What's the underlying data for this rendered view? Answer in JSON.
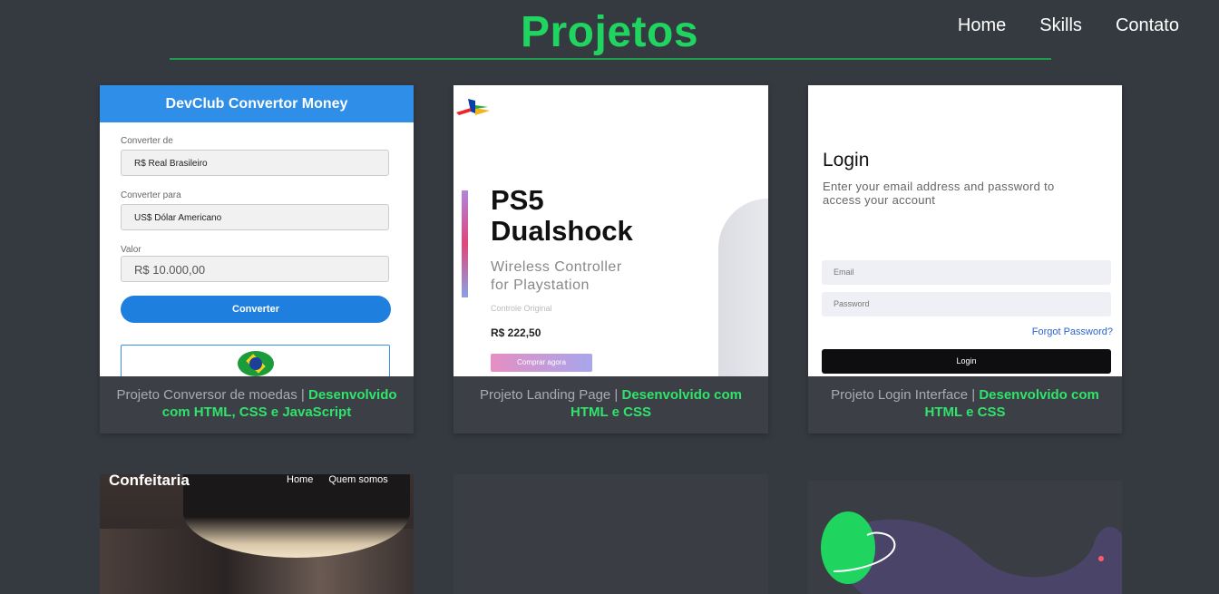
{
  "header": {
    "title": "Projetos",
    "nav": [
      "Home",
      "Skills",
      "Contato"
    ]
  },
  "colors": {
    "accent": "#1fd560",
    "background": "#353a40",
    "card": "#3c4046"
  },
  "projects": [
    {
      "caption_text": "Projeto Conversor de moedas | ",
      "caption_highlight": "Desenvolvido com HTML, CSS e JavaScript",
      "preview": {
        "heading": "DevClub Convertor Money",
        "label_from": "Converter de",
        "value_from": "R$ Real Brasileiro",
        "label_to": "Converter para",
        "value_to": "US$ Dólar Americano",
        "label_value": "Valor",
        "value_amount": "R$ 10.000,00",
        "button": "Converter"
      }
    },
    {
      "caption_text": "Projeto Landing Page | ",
      "caption_highlight": "Desenvolvido com HTML e CSS",
      "preview": {
        "title_line1": "PS5",
        "title_line2": "Dualshock",
        "subtitle_line1": "Wireless Controller",
        "subtitle_line2": "for Playstation",
        "small": "Controle Original",
        "price": "R$ 222,50",
        "button": "Comprar agora"
      }
    },
    {
      "caption_text": "Projeto Login Interface | ",
      "caption_highlight": "Desenvolvido com HTML e CSS",
      "preview": {
        "title": "Login",
        "subtitle": "Enter your email address and password to access your account",
        "email_placeholder": "Email",
        "password_placeholder": "Password",
        "forgot": "Forgot Password?",
        "button": "Login"
      }
    }
  ],
  "row2": {
    "confeitaria_logo": "Confeitaria",
    "confeitaria_nav": [
      "Home",
      "Quem somos"
    ]
  }
}
